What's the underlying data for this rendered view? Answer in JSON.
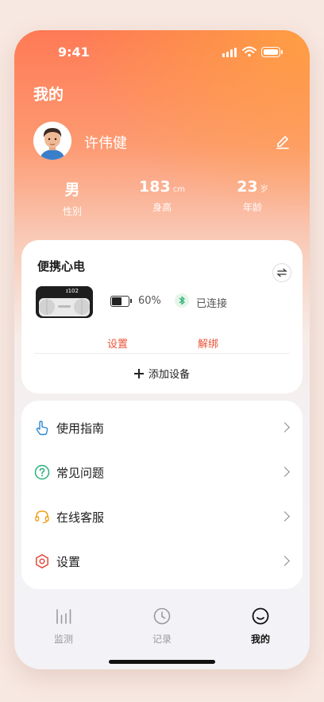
{
  "status": {
    "time": "9:41"
  },
  "header": {
    "title": "我的"
  },
  "profile": {
    "name": "许伟健"
  },
  "stats": [
    {
      "value": "男",
      "unit": "",
      "label": "性别"
    },
    {
      "value": "183",
      "unit": "cm",
      "label": "身高"
    },
    {
      "value": "23",
      "unit": "岁",
      "label": "年龄"
    }
  ],
  "device": {
    "title": "便携心电",
    "display_text": "ɪ102",
    "battery_percent": "60%",
    "battery_level": 0.6,
    "connection": "已连接",
    "action_settings": "设置",
    "action_unbind": "解绑",
    "add_device": "添加设备",
    "accent": "#e9553a"
  },
  "menu": [
    {
      "label": "使用指南",
      "icon": "hand-pointer-icon",
      "color": "#2f86d6"
    },
    {
      "label": "常见问题",
      "icon": "question-circle-icon",
      "color": "#2bb07a"
    },
    {
      "label": "在线客服",
      "icon": "headset-icon",
      "color": "#f0a020"
    },
    {
      "label": "设置",
      "icon": "hexagon-settings-icon",
      "color": "#e44a3c"
    }
  ],
  "tabs": [
    {
      "label": "监测",
      "icon": "monitor-bars-icon",
      "active": false
    },
    {
      "label": "记录",
      "icon": "clock-icon",
      "active": false
    },
    {
      "label": "我的",
      "icon": "smiley-icon",
      "active": true
    }
  ]
}
